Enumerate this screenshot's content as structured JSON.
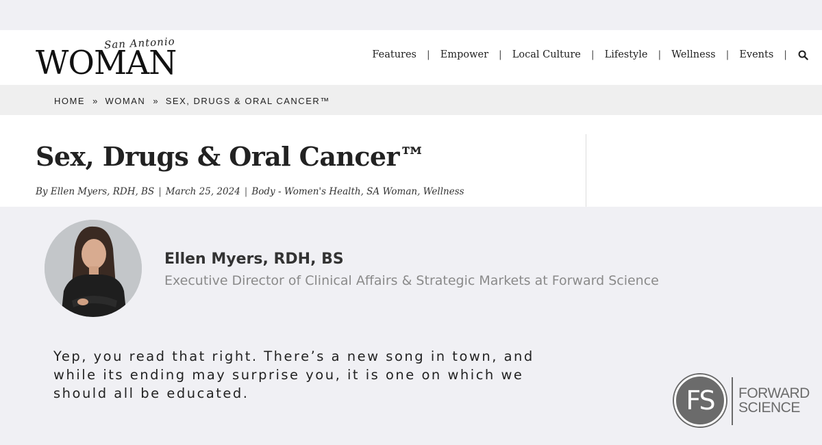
{
  "header": {
    "logo_script": "San Antonio",
    "logo_word": "WOMAN",
    "nav": [
      "Features",
      "Empower",
      "Local Culture",
      "Lifestyle",
      "Wellness",
      "Events"
    ],
    "search_icon": "search-icon"
  },
  "breadcrumb": {
    "items": [
      "HOME",
      "WOMAN",
      "SEX, DRUGS & ORAL CANCER™"
    ],
    "separator": "»"
  },
  "article": {
    "title": "Sex, Drugs & Oral Cancer™",
    "byline": {
      "author": "By Ellen Myers, RDH, BS",
      "date": "March 25, 2024",
      "categories": "Body - Women's Health, SA Woman, Wellness"
    }
  },
  "author_card": {
    "name": "Ellen Myers, RDH, BS",
    "role": "Executive Director of Clinical Affairs & Strategic Markets at Forward Science"
  },
  "excerpt": {
    "lines": [
      "Yep, you read that right.  There’s a new song in town, and",
      "while its ending may surprise you, it is one on which we",
      "should all be educated."
    ]
  },
  "brand_logo": {
    "monogram": "FS",
    "line1": "FORWARD",
    "line2": "SCIENCE"
  },
  "colors": {
    "page_bg": "#f0f0f4",
    "header_bg": "#ffffff",
    "breadcrumb_bg": "#efefef",
    "role_text": "#8a8a8a",
    "brand_gray": "#6b6b6b"
  }
}
